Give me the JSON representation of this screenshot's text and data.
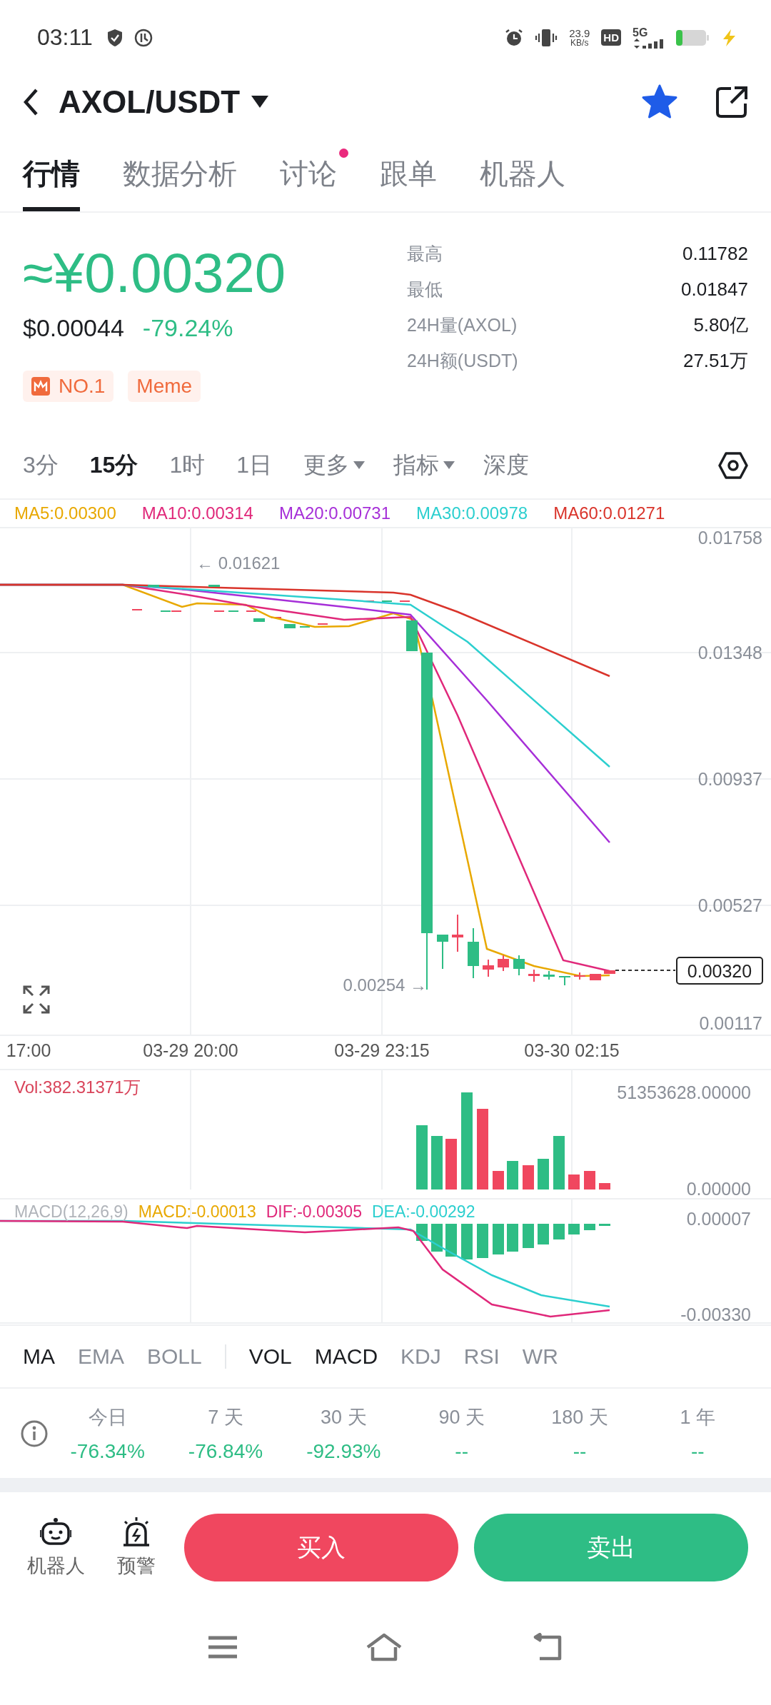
{
  "status_bar": {
    "time": "03:11",
    "net_speed": "23.9",
    "net_unit": "KB/s",
    "hd": "HD",
    "network": "5G"
  },
  "header": {
    "pair": "AXOL/USDT",
    "favorite": true
  },
  "tabs": [
    {
      "label": "行情",
      "selected": true,
      "badge": false
    },
    {
      "label": "数据分析",
      "selected": false,
      "badge": false
    },
    {
      "label": "讨论",
      "selected": false,
      "badge": true
    },
    {
      "label": "跟单",
      "selected": false,
      "badge": false
    },
    {
      "label": "机器人",
      "selected": false,
      "badge": false
    }
  ],
  "price": {
    "main": "≈¥0.00320",
    "usd": "$0.00044",
    "change": "-79.24%"
  },
  "tags": [
    {
      "kind": "rank",
      "label": "NO.1"
    },
    {
      "kind": "plain",
      "label": "Meme"
    }
  ],
  "stats": [
    {
      "label": "最高",
      "value": "0.11782"
    },
    {
      "label": "最低",
      "value": "0.01847"
    },
    {
      "label": "24H量(AXOL)",
      "value": "5.80亿"
    },
    {
      "label": "24H额(USDT)",
      "value": "27.51万"
    }
  ],
  "timeframes": [
    {
      "label": "3分",
      "selected": false,
      "dropdown": false
    },
    {
      "label": "15分",
      "selected": true,
      "dropdown": false
    },
    {
      "label": "1时",
      "selected": false,
      "dropdown": false
    },
    {
      "label": "1日",
      "selected": false,
      "dropdown": false
    },
    {
      "label": "更多",
      "selected": false,
      "dropdown": true
    },
    {
      "label": "指标",
      "selected": false,
      "dropdown": true
    },
    {
      "label": "深度",
      "selected": false,
      "dropdown": false
    }
  ],
  "ma_legend": [
    {
      "label": "MA5:0.00300",
      "color": "#e8a800"
    },
    {
      "label": "MA10:0.00314",
      "color": "#e0287a"
    },
    {
      "label": "MA20:0.00731",
      "color": "#a62fd8"
    },
    {
      "label": "MA30:0.00978",
      "color": "#2ccfcf"
    },
    {
      "label": "MA60:0.01271",
      "color": "#d9342b"
    }
  ],
  "price_chart": {
    "y_labels": [
      "0.01758",
      "0.01348",
      "0.00937",
      "0.00527",
      "0.00117"
    ],
    "x_labels": [
      "17:00",
      "03-29 20:00",
      "03-29 23:15",
      "03-30 02:15"
    ],
    "high_marker": "← 0.01621",
    "low_marker": "0.00254 →",
    "last_price": "0.00320"
  },
  "volume": {
    "label": "Vol:382.31371万",
    "y_labels": [
      "51353628.00000",
      "0.00000"
    ]
  },
  "macd": {
    "labels": [
      {
        "text": "MACD(12,26,9)",
        "color": "#b0b4ba"
      },
      {
        "text": "MACD:-0.00013",
        "color": "#e8a800"
      },
      {
        "text": "DIF:-0.00305",
        "color": "#e0287a"
      },
      {
        "text": "DEA:-0.00292",
        "color": "#2ccfcf"
      }
    ],
    "y_labels": [
      "0.00007",
      "-0.00330"
    ]
  },
  "indicators": [
    {
      "label": "MA",
      "selected": true,
      "separator_before": false
    },
    {
      "label": "EMA",
      "selected": false,
      "separator_before": false
    },
    {
      "label": "BOLL",
      "selected": false,
      "separator_before": false
    },
    {
      "label": "VOL",
      "selected": true,
      "separator_before": true
    },
    {
      "label": "MACD",
      "selected": true,
      "separator_before": false
    },
    {
      "label": "KDJ",
      "selected": false,
      "separator_before": false
    },
    {
      "label": "RSI",
      "selected": false,
      "separator_before": false
    },
    {
      "label": "WR",
      "selected": false,
      "separator_before": false
    }
  ],
  "returns": [
    {
      "period": "今日",
      "value": "-76.34%"
    },
    {
      "period": "7 天",
      "value": "-76.84%"
    },
    {
      "period": "30 天",
      "value": "-92.93%"
    },
    {
      "period": "90 天",
      "value": "--"
    },
    {
      "period": "180 天",
      "value": "--"
    },
    {
      "period": "1 年",
      "value": "--"
    }
  ],
  "actions": {
    "robot": "机器人",
    "alert": "预警",
    "buy": "买入",
    "sell": "卖出"
  }
}
